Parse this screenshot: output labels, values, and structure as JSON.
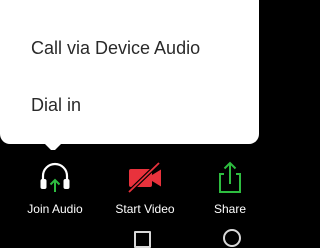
{
  "popup_menu": {
    "items": [
      {
        "label": "Call via Device Audio"
      },
      {
        "label": "Dial in"
      }
    ]
  },
  "toolbar": {
    "items": [
      {
        "label": "Join Audio",
        "icon": "headphones-icon"
      },
      {
        "label": "Start Video",
        "icon": "video-off-icon"
      },
      {
        "label": "Share",
        "icon": "share-icon"
      }
    ]
  },
  "navbar": {
    "items": [
      {
        "icon": "recents-square-icon"
      },
      {
        "icon": "home-circle-icon"
      }
    ]
  },
  "colors": {
    "background": "#000000",
    "popup_background": "#ffffff",
    "menu_text": "#2a2a2a",
    "toolbar_text": "#ffffff",
    "join_audio_arrow": "#2ebd40",
    "video_off_red": "#e8323c",
    "share_green": "#2ebd40"
  }
}
